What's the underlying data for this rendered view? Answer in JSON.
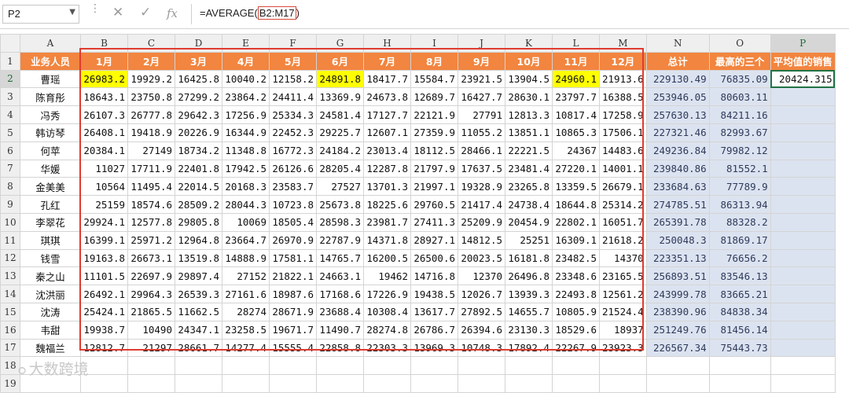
{
  "formula_bar": {
    "name_box": "P2",
    "cancel_icon": "✕",
    "enter_icon": "✓",
    "fx_label": "fx",
    "formula_prefix": "=AVERAGE(",
    "formula_ref": "B2:M17",
    "formula_suffix": ")"
  },
  "columns": [
    "A",
    "B",
    "C",
    "D",
    "E",
    "F",
    "G",
    "H",
    "I",
    "J",
    "K",
    "L",
    "M",
    "N",
    "O",
    "P"
  ],
  "header_row": [
    "业务人员",
    "1月",
    "2月",
    "3月",
    "4月",
    "5月",
    "6月",
    "7月",
    "8月",
    "9月",
    "10月",
    "11月",
    "12月",
    "总计",
    "最高的三个",
    "平均值的销售"
  ],
  "rows": [
    {
      "n": "2",
      "name": "曹瑶",
      "m": [
        "26983.2",
        "19929.2",
        "16425.8",
        "10040.2",
        "12158.2",
        "24891.8",
        "18417.7",
        "15584.7",
        "23921.5",
        "13904.5",
        "24960.1",
        "21913.6"
      ],
      "total": "229130.49",
      "top3": "76835.09",
      "avg": "20424.315"
    },
    {
      "n": "3",
      "name": "陈育彤",
      "m": [
        "18643.1",
        "23750.8",
        "27299.2",
        "23864.2",
        "24411.4",
        "13369.9",
        "24673.8",
        "12689.7",
        "16427.7",
        "28630.1",
        "23797.7",
        "16388.5"
      ],
      "total": "253946.05",
      "top3": "80603.11",
      "avg": ""
    },
    {
      "n": "4",
      "name": "冯秀",
      "m": [
        "26107.3",
        "26777.8",
        "29642.3",
        "17256.9",
        "25334.3",
        "24581.4",
        "17127.7",
        "22121.9",
        "27791",
        "12813.3",
        "10817.4",
        "17258.9"
      ],
      "total": "257630.13",
      "top3": "84211.16",
      "avg": ""
    },
    {
      "n": "5",
      "name": "韩访琴",
      "m": [
        "26408.1",
        "19418.9",
        "20226.9",
        "16344.9",
        "22452.3",
        "29225.7",
        "12607.1",
        "27359.9",
        "11055.2",
        "13851.1",
        "10865.3",
        "17506.1"
      ],
      "total": "227321.46",
      "top3": "82993.67",
      "avg": ""
    },
    {
      "n": "6",
      "name": "何苹",
      "m": [
        "20384.1",
        "27149",
        "18734.2",
        "11348.8",
        "16772.3",
        "24184.2",
        "23013.4",
        "18112.5",
        "28466.1",
        "22221.5",
        "24367",
        "14483.6"
      ],
      "total": "249236.84",
      "top3": "79982.12",
      "avg": ""
    },
    {
      "n": "7",
      "name": "华媛",
      "m": [
        "11027",
        "17711.9",
        "22401.8",
        "17942.5",
        "26126.6",
        "28205.4",
        "12287.8",
        "21797.9",
        "17637.5",
        "23481.4",
        "27220.1",
        "14001.1"
      ],
      "total": "239840.86",
      "top3": "81552.1",
      "avg": ""
    },
    {
      "n": "8",
      "name": "金美美",
      "m": [
        "10564",
        "11495.4",
        "22014.5",
        "20168.3",
        "23583.7",
        "27527",
        "13701.3",
        "21997.1",
        "19328.9",
        "23265.8",
        "13359.5",
        "26679.1"
      ],
      "total": "233684.63",
      "top3": "77789.9",
      "avg": ""
    },
    {
      "n": "9",
      "name": "孔红",
      "m": [
        "25159",
        "18574.6",
        "28509.2",
        "28044.3",
        "10723.8",
        "25673.8",
        "18225.6",
        "29760.5",
        "21417.4",
        "24738.4",
        "18644.8",
        "25314.2"
      ],
      "total": "274785.51",
      "top3": "86313.94",
      "avg": ""
    },
    {
      "n": "10",
      "name": "李翠花",
      "m": [
        "29924.1",
        "12577.8",
        "29805.8",
        "10069",
        "18505.4",
        "28598.3",
        "23981.7",
        "27411.3",
        "25209.9",
        "20454.9",
        "22802.1",
        "16051.7"
      ],
      "total": "265391.78",
      "top3": "88328.2",
      "avg": ""
    },
    {
      "n": "11",
      "name": "琪琪",
      "m": [
        "16399.1",
        "25971.2",
        "12964.8",
        "23664.7",
        "26970.9",
        "22787.9",
        "14371.8",
        "28927.1",
        "14812.5",
        "25251",
        "16309.1",
        "21618.2"
      ],
      "total": "250048.3",
      "top3": "81869.17",
      "avg": ""
    },
    {
      "n": "12",
      "name": "钱雪",
      "m": [
        "19163.8",
        "26673.1",
        "13519.8",
        "14888.9",
        "17581.1",
        "14765.7",
        "16200.5",
        "26500.6",
        "20023.5",
        "16181.8",
        "23482.5",
        "14370"
      ],
      "total": "223351.13",
      "top3": "76656.2",
      "avg": ""
    },
    {
      "n": "13",
      "name": "秦之山",
      "m": [
        "11101.5",
        "22697.9",
        "29897.4",
        "27152",
        "21822.1",
        "24663.1",
        "19462",
        "14716.8",
        "12370",
        "26496.8",
        "23348.6",
        "23165.5"
      ],
      "total": "256893.51",
      "top3": "83546.13",
      "avg": ""
    },
    {
      "n": "14",
      "name": "沈洪丽",
      "m": [
        "26492.1",
        "29964.3",
        "26539.3",
        "27161.6",
        "18987.6",
        "17168.6",
        "17226.9",
        "19438.5",
        "12026.7",
        "13939.3",
        "22493.8",
        "12561.2"
      ],
      "total": "243999.78",
      "top3": "83665.21",
      "avg": ""
    },
    {
      "n": "15",
      "name": "沈涛",
      "m": [
        "25424.1",
        "21865.5",
        "11662.5",
        "28274",
        "28671.9",
        "23688.4",
        "10308.4",
        "13617.7",
        "27892.5",
        "14655.7",
        "10805.9",
        "21524.4"
      ],
      "total": "238390.96",
      "top3": "84838.34",
      "avg": ""
    },
    {
      "n": "16",
      "name": "韦甜",
      "m": [
        "19938.7",
        "10490",
        "24347.1",
        "23258.5",
        "19671.7",
        "11490.7",
        "28274.8",
        "26786.7",
        "26394.6",
        "23130.3",
        "18529.6",
        "18937"
      ],
      "total": "251249.76",
      "top3": "81456.14",
      "avg": ""
    },
    {
      "n": "17",
      "name": "魏福兰",
      "m": [
        "12812.7",
        "21297",
        "28661.7",
        "14277.4",
        "15555.4",
        "22858.8",
        "22303.3",
        "13969.3",
        "10748.3",
        "17892.4",
        "22267.9",
        "23923.3"
      ],
      "total": "226567.34",
      "top3": "75443.73",
      "avg": ""
    }
  ],
  "extra_rows": [
    "18",
    "19"
  ],
  "watermark": "大数跨境",
  "colors": {
    "header_orange": "#f2853f",
    "highlight_yellow": "#ffff00",
    "summary_blue": "#dce3f0",
    "range_red": "#e03b30",
    "selection_green": "#217346"
  }
}
